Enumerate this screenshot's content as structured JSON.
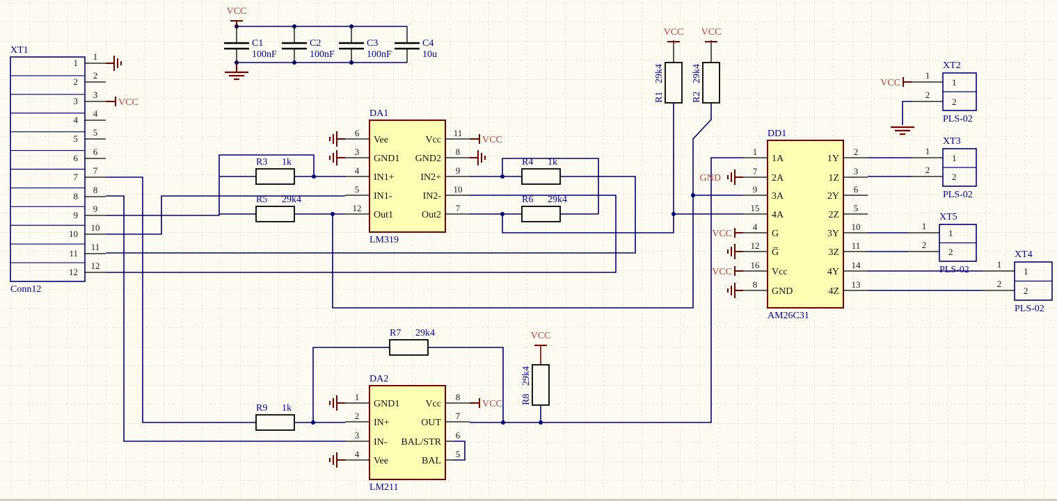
{
  "power": {
    "vcc": "VCC",
    "gnd": "GND"
  },
  "capacitors": [
    {
      "ref": "C1",
      "value": "100nF"
    },
    {
      "ref": "C2",
      "value": "100nF"
    },
    {
      "ref": "C3",
      "value": "100nF"
    },
    {
      "ref": "C4",
      "value": "10u"
    }
  ],
  "resistors": {
    "r1": {
      "ref": "R1",
      "value": "29k4"
    },
    "r2": {
      "ref": "R2",
      "value": "29k4"
    },
    "r3": {
      "ref": "R3",
      "value": "1k"
    },
    "r4": {
      "ref": "R4",
      "value": "1k"
    },
    "r5": {
      "ref": "R5",
      "value": "29k4"
    },
    "r6": {
      "ref": "R6",
      "value": "29k4"
    },
    "r7": {
      "ref": "R7",
      "value": "29k4"
    },
    "r8": {
      "ref": "R8",
      "value": "29k4"
    },
    "r9": {
      "ref": "R9",
      "value": "1k"
    }
  },
  "ics": {
    "da1": {
      "ref": "DA1",
      "part": "LM319",
      "left": [
        {
          "num": "6",
          "name": "Vee"
        },
        {
          "num": "3",
          "name": "GND1"
        },
        {
          "num": "4",
          "name": "IN1+"
        },
        {
          "num": "5",
          "name": "IN1-"
        },
        {
          "num": "12",
          "name": "Out1"
        }
      ],
      "right": [
        {
          "num": "11",
          "name": "Vcc"
        },
        {
          "num": "8",
          "name": "GND2"
        },
        {
          "num": "9",
          "name": "IN2+"
        },
        {
          "num": "10",
          "name": "IN2-"
        },
        {
          "num": "7",
          "name": "Out2"
        }
      ]
    },
    "dd1": {
      "ref": "DD1",
      "part": "AM26C31",
      "left": [
        {
          "num": "1",
          "name": "1A"
        },
        {
          "num": "7",
          "name": "2A"
        },
        {
          "num": "9",
          "name": "3A"
        },
        {
          "num": "15",
          "name": "4A"
        },
        {
          "num": "4",
          "name": "G"
        },
        {
          "num": "12",
          "name": "G̅"
        },
        {
          "num": "16",
          "name": "Vcc"
        },
        {
          "num": "8",
          "name": "GND"
        }
      ],
      "right": [
        {
          "num": "2",
          "name": "1Y"
        },
        {
          "num": "3",
          "name": "1Z"
        },
        {
          "num": "6",
          "name": "2Y"
        },
        {
          "num": "5",
          "name": "2Z"
        },
        {
          "num": "10",
          "name": "3Y"
        },
        {
          "num": "11",
          "name": "3Z"
        },
        {
          "num": "14",
          "name": "4Y"
        },
        {
          "num": "13",
          "name": "4Z"
        }
      ]
    },
    "da2": {
      "ref": "DA2",
      "part": "LM211",
      "left": [
        {
          "num": "1",
          "name": "GND1"
        },
        {
          "num": "2",
          "name": "IN+"
        },
        {
          "num": "3",
          "name": "IN-"
        },
        {
          "num": "4",
          "name": "Vee"
        }
      ],
      "right": [
        {
          "num": "8",
          "name": "Vcc"
        },
        {
          "num": "7",
          "name": "OUT"
        },
        {
          "num": "6",
          "name": "BAL/STR"
        },
        {
          "num": "5",
          "name": "BAL"
        }
      ]
    }
  },
  "connectors": {
    "xt1": {
      "ref": "XT1",
      "part": "Conn12",
      "pins": [
        "1",
        "2",
        "3",
        "4",
        "5",
        "6",
        "7",
        "8",
        "9",
        "10",
        "11",
        "12"
      ]
    },
    "xt2": {
      "ref": "XT2",
      "part": "PLS-02",
      "pins": [
        "1",
        "2"
      ]
    },
    "xt3": {
      "ref": "XT3",
      "part": "PLS-02",
      "pins": [
        "1",
        "2"
      ]
    },
    "xt4": {
      "ref": "XT4",
      "part": "PLS-02",
      "pins": [
        "1",
        "2"
      ]
    },
    "xt5": {
      "ref": "XT5",
      "part": "PLS-02",
      "pins": [
        "1",
        "2"
      ]
    }
  }
}
